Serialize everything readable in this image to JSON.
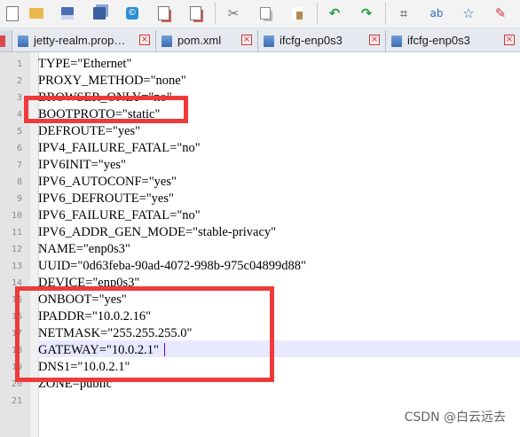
{
  "toolbar": {
    "icons": [
      "new-file-icon",
      "open-folder-icon",
      "save-icon",
      "save-all-icon",
      "close-icon",
      "close-all-icon",
      "print-icon",
      "cut-icon",
      "copy-icon",
      "paste-icon",
      "undo-icon",
      "redo-icon",
      "find-icon",
      "replace-icon",
      "zoom-icon",
      "macro-icon"
    ]
  },
  "tabs": [
    {
      "label": "jetty-realm.prop…"
    },
    {
      "label": "pom.xml"
    },
    {
      "label": "ifcfg-enp0s3"
    },
    {
      "label": "ifcfg-enp0s3"
    }
  ],
  "editor": {
    "lines": [
      {
        "num": "1",
        "text": "TYPE=\"Ethernet\""
      },
      {
        "num": "2",
        "text": "PROXY_METHOD=\"none\""
      },
      {
        "num": "3",
        "text": "BROWSER_ONLY=\"no\""
      },
      {
        "num": "4",
        "text": "BOOTPROTO=\"static\""
      },
      {
        "num": "5",
        "text": "DEFROUTE=\"yes\""
      },
      {
        "num": "6",
        "text": "IPV4_FAILURE_FATAL=\"no\""
      },
      {
        "num": "7",
        "text": "IPV6INIT=\"yes\""
      },
      {
        "num": "8",
        "text": "IPV6_AUTOCONF=\"yes\""
      },
      {
        "num": "9",
        "text": "IPV6_DEFROUTE=\"yes\""
      },
      {
        "num": "10",
        "text": "IPV6_FAILURE_FATAL=\"no\""
      },
      {
        "num": "11",
        "text": "IPV6_ADDR_GEN_MODE=\"stable-privacy\""
      },
      {
        "num": "12",
        "text": "NAME=\"enp0s3\""
      },
      {
        "num": "13",
        "text": "UUID=\"0d63feba-90ad-4072-998b-975c04899d88\""
      },
      {
        "num": "14",
        "text": "DEVICE=\"enp0s3\""
      },
      {
        "num": "15",
        "text": "ONBOOT=\"yes\""
      },
      {
        "num": "16",
        "text": "IPADDR=\"10.0.2.16\""
      },
      {
        "num": "17",
        "text": "NETMASK=\"255.255.255.0\""
      },
      {
        "num": "18",
        "text": "GATEWAY=\"10.0.2.1\""
      },
      {
        "num": "19",
        "text": "DNS1=\"10.0.2.1\""
      },
      {
        "num": "20",
        "text": "ZONE=public"
      },
      {
        "num": "21",
        "text": ""
      }
    ],
    "current_line": "18"
  },
  "annotation_color": "#ee3a3a",
  "watermark": "CSDN @白云远去"
}
